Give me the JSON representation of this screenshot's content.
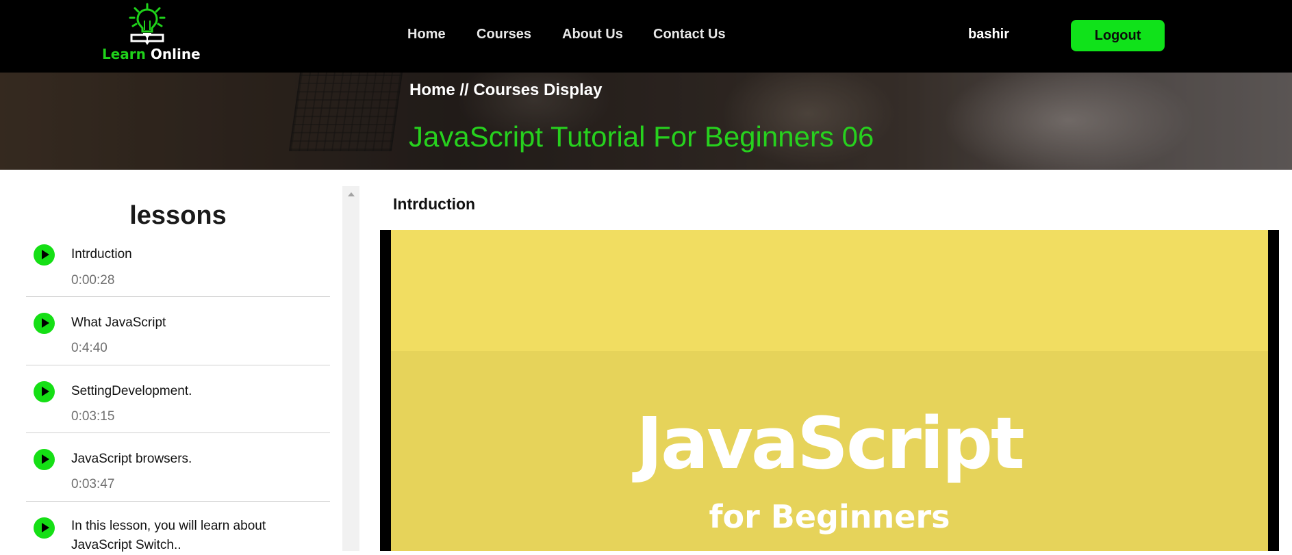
{
  "header": {
    "logo": {
      "learn": "Learn",
      "online": "Online"
    },
    "nav": [
      {
        "label": "Home"
      },
      {
        "label": "Courses"
      },
      {
        "label": "About Us"
      },
      {
        "label": "Contact Us"
      }
    ],
    "username": "bashir",
    "logout_label": "Logout"
  },
  "banner": {
    "breadcrumb": "Home // Courses Display",
    "title": "JavaScript Tutorial For Beginners 06"
  },
  "sidebar": {
    "title": "lessons",
    "lessons": [
      {
        "title": "Intrduction",
        "duration": "0:00:28"
      },
      {
        "title": "What JavaScript",
        "duration": "0:4:40"
      },
      {
        "title": "SettingDevelopment.",
        "duration": "0:03:15"
      },
      {
        "title": "JavaScript browsers.",
        "duration": "0:03:47"
      },
      {
        "title": "In this lesson, you will learn about JavaScript Switch..",
        "duration": ""
      }
    ]
  },
  "main": {
    "lesson_heading": "Intrduction",
    "video": {
      "title": "JavaScript",
      "subtitle": "for Beginners"
    }
  },
  "colors": {
    "accent_green": "#10e21a",
    "title_green": "#27d11e",
    "header_bg": "#000000",
    "video_yellow": "#e6d35a"
  },
  "icons": [
    "lightbulb-book-logo-icon",
    "play-circle-icon",
    "scroll-up-arrow-icon"
  ]
}
